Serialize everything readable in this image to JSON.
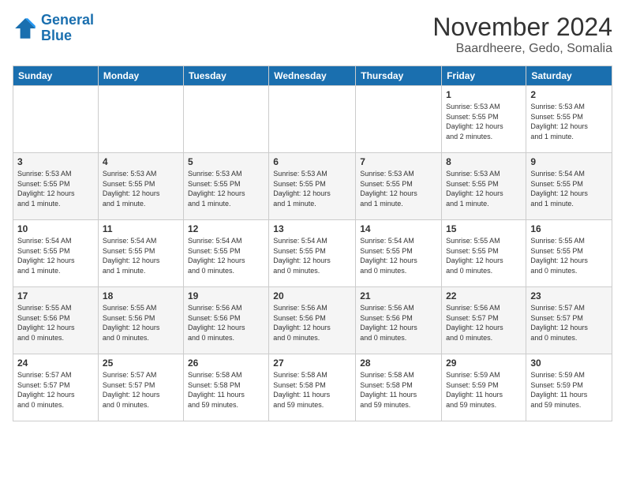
{
  "logo": {
    "line1": "General",
    "line2": "Blue"
  },
  "title": "November 2024",
  "location": "Baardheere, Gedo, Somalia",
  "weekdays": [
    "Sunday",
    "Monday",
    "Tuesday",
    "Wednesday",
    "Thursday",
    "Friday",
    "Saturday"
  ],
  "weeks": [
    [
      {
        "day": "",
        "info": ""
      },
      {
        "day": "",
        "info": ""
      },
      {
        "day": "",
        "info": ""
      },
      {
        "day": "",
        "info": ""
      },
      {
        "day": "",
        "info": ""
      },
      {
        "day": "1",
        "info": "Sunrise: 5:53 AM\nSunset: 5:55 PM\nDaylight: 12 hours\nand 2 minutes."
      },
      {
        "day": "2",
        "info": "Sunrise: 5:53 AM\nSunset: 5:55 PM\nDaylight: 12 hours\nand 1 minute."
      }
    ],
    [
      {
        "day": "3",
        "info": "Sunrise: 5:53 AM\nSunset: 5:55 PM\nDaylight: 12 hours\nand 1 minute."
      },
      {
        "day": "4",
        "info": "Sunrise: 5:53 AM\nSunset: 5:55 PM\nDaylight: 12 hours\nand 1 minute."
      },
      {
        "day": "5",
        "info": "Sunrise: 5:53 AM\nSunset: 5:55 PM\nDaylight: 12 hours\nand 1 minute."
      },
      {
        "day": "6",
        "info": "Sunrise: 5:53 AM\nSunset: 5:55 PM\nDaylight: 12 hours\nand 1 minute."
      },
      {
        "day": "7",
        "info": "Sunrise: 5:53 AM\nSunset: 5:55 PM\nDaylight: 12 hours\nand 1 minute."
      },
      {
        "day": "8",
        "info": "Sunrise: 5:53 AM\nSunset: 5:55 PM\nDaylight: 12 hours\nand 1 minute."
      },
      {
        "day": "9",
        "info": "Sunrise: 5:54 AM\nSunset: 5:55 PM\nDaylight: 12 hours\nand 1 minute."
      }
    ],
    [
      {
        "day": "10",
        "info": "Sunrise: 5:54 AM\nSunset: 5:55 PM\nDaylight: 12 hours\nand 1 minute."
      },
      {
        "day": "11",
        "info": "Sunrise: 5:54 AM\nSunset: 5:55 PM\nDaylight: 12 hours\nand 1 minute."
      },
      {
        "day": "12",
        "info": "Sunrise: 5:54 AM\nSunset: 5:55 PM\nDaylight: 12 hours\nand 0 minutes."
      },
      {
        "day": "13",
        "info": "Sunrise: 5:54 AM\nSunset: 5:55 PM\nDaylight: 12 hours\nand 0 minutes."
      },
      {
        "day": "14",
        "info": "Sunrise: 5:54 AM\nSunset: 5:55 PM\nDaylight: 12 hours\nand 0 minutes."
      },
      {
        "day": "15",
        "info": "Sunrise: 5:55 AM\nSunset: 5:55 PM\nDaylight: 12 hours\nand 0 minutes."
      },
      {
        "day": "16",
        "info": "Sunrise: 5:55 AM\nSunset: 5:55 PM\nDaylight: 12 hours\nand 0 minutes."
      }
    ],
    [
      {
        "day": "17",
        "info": "Sunrise: 5:55 AM\nSunset: 5:56 PM\nDaylight: 12 hours\nand 0 minutes."
      },
      {
        "day": "18",
        "info": "Sunrise: 5:55 AM\nSunset: 5:56 PM\nDaylight: 12 hours\nand 0 minutes."
      },
      {
        "day": "19",
        "info": "Sunrise: 5:56 AM\nSunset: 5:56 PM\nDaylight: 12 hours\nand 0 minutes."
      },
      {
        "day": "20",
        "info": "Sunrise: 5:56 AM\nSunset: 5:56 PM\nDaylight: 12 hours\nand 0 minutes."
      },
      {
        "day": "21",
        "info": "Sunrise: 5:56 AM\nSunset: 5:56 PM\nDaylight: 12 hours\nand 0 minutes."
      },
      {
        "day": "22",
        "info": "Sunrise: 5:56 AM\nSunset: 5:57 PM\nDaylight: 12 hours\nand 0 minutes."
      },
      {
        "day": "23",
        "info": "Sunrise: 5:57 AM\nSunset: 5:57 PM\nDaylight: 12 hours\nand 0 minutes."
      }
    ],
    [
      {
        "day": "24",
        "info": "Sunrise: 5:57 AM\nSunset: 5:57 PM\nDaylight: 12 hours\nand 0 minutes."
      },
      {
        "day": "25",
        "info": "Sunrise: 5:57 AM\nSunset: 5:57 PM\nDaylight: 12 hours\nand 0 minutes."
      },
      {
        "day": "26",
        "info": "Sunrise: 5:58 AM\nSunset: 5:58 PM\nDaylight: 11 hours\nand 59 minutes."
      },
      {
        "day": "27",
        "info": "Sunrise: 5:58 AM\nSunset: 5:58 PM\nDaylight: 11 hours\nand 59 minutes."
      },
      {
        "day": "28",
        "info": "Sunrise: 5:58 AM\nSunset: 5:58 PM\nDaylight: 11 hours\nand 59 minutes."
      },
      {
        "day": "29",
        "info": "Sunrise: 5:59 AM\nSunset: 5:59 PM\nDaylight: 11 hours\nand 59 minutes."
      },
      {
        "day": "30",
        "info": "Sunrise: 5:59 AM\nSunset: 5:59 PM\nDaylight: 11 hours\nand 59 minutes."
      }
    ]
  ]
}
